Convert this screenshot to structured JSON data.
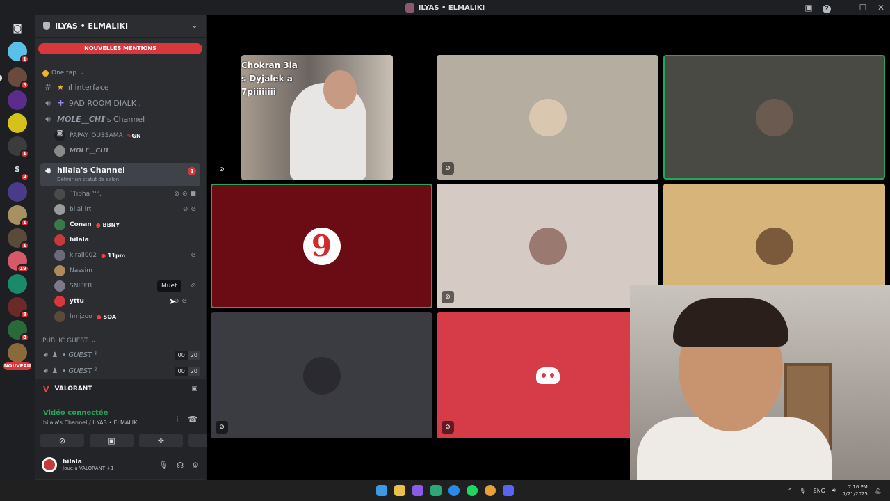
{
  "window": {
    "title": "ILYAS • ELMALIKI"
  },
  "server_rail": {
    "badges": [
      "1",
      "3",
      "1",
      "2",
      "1",
      "1",
      "19",
      "8",
      "8"
    ],
    "new_label": "NOUVEAU",
    "text_icon": "S"
  },
  "sidebar": {
    "server_name": "ILYAS • ELMALIKI",
    "mentions_banner": "NOUVELLES MENTIONS",
    "category_one_tap": "One tap",
    "channels": {
      "interface": "ıl interface",
      "room": "9AD ROOM DIALK .",
      "mole_channel": "𝙈𝙊𝙇𝙀__𝘾𝙃𝙄's Channel",
      "hilala_channel": "hilala's Channel",
      "hilala_sub": "Définir un statut de salon",
      "hilala_badge": "1"
    },
    "mole_users": [
      {
        "name": "PAPAY_OUSSAMA",
        "tag": "GN"
      },
      {
        "name": "𝙈𝙊𝙇𝙀__𝘾𝙃𝙄",
        "tag": ""
      }
    ],
    "voice_users": [
      {
        "name": "`Tipha ³¹²,",
        "tag": ""
      },
      {
        "name": "bilal irt",
        "tag": ""
      },
      {
        "name": "Conan",
        "tag": "BBNY"
      },
      {
        "name": "hilala",
        "tag": ""
      },
      {
        "name": "kirali002",
        "tag": "11pm"
      },
      {
        "name": "Nassim",
        "tag": ""
      },
      {
        "name": "SNIPER",
        "tag": ""
      },
      {
        "name": "yttu",
        "tag": ""
      },
      {
        "name": "ẖmįzoo",
        "tag": "SOA"
      }
    ],
    "tooltip": "Muet",
    "category_public": "PUBLIC GUEST",
    "guests": [
      {
        "name": "• GUEST ¹",
        "count": "00",
        "limit": "20"
      },
      {
        "name": "• GUEST ²",
        "count": "00",
        "limit": "20"
      }
    ],
    "activity": "VALORANT",
    "voice_status": "Vidéo connectée",
    "voice_location": "hilala's Channel / ILYAS • ELMALIKI",
    "user": {
      "name": "hilala",
      "status": "Joue à VALORANT +1"
    }
  },
  "stage": {
    "video_caption": "Chokran 3la\ns Dyjalek a\n7piiiiiiii"
  },
  "taskbar": {
    "lang": "ENG",
    "time": "7:16 PM",
    "date": "7/21/2025"
  },
  "colors": {
    "accent_red": "#da373c",
    "online_green": "#23a55a",
    "sidebar_bg": "#2b2d31"
  }
}
